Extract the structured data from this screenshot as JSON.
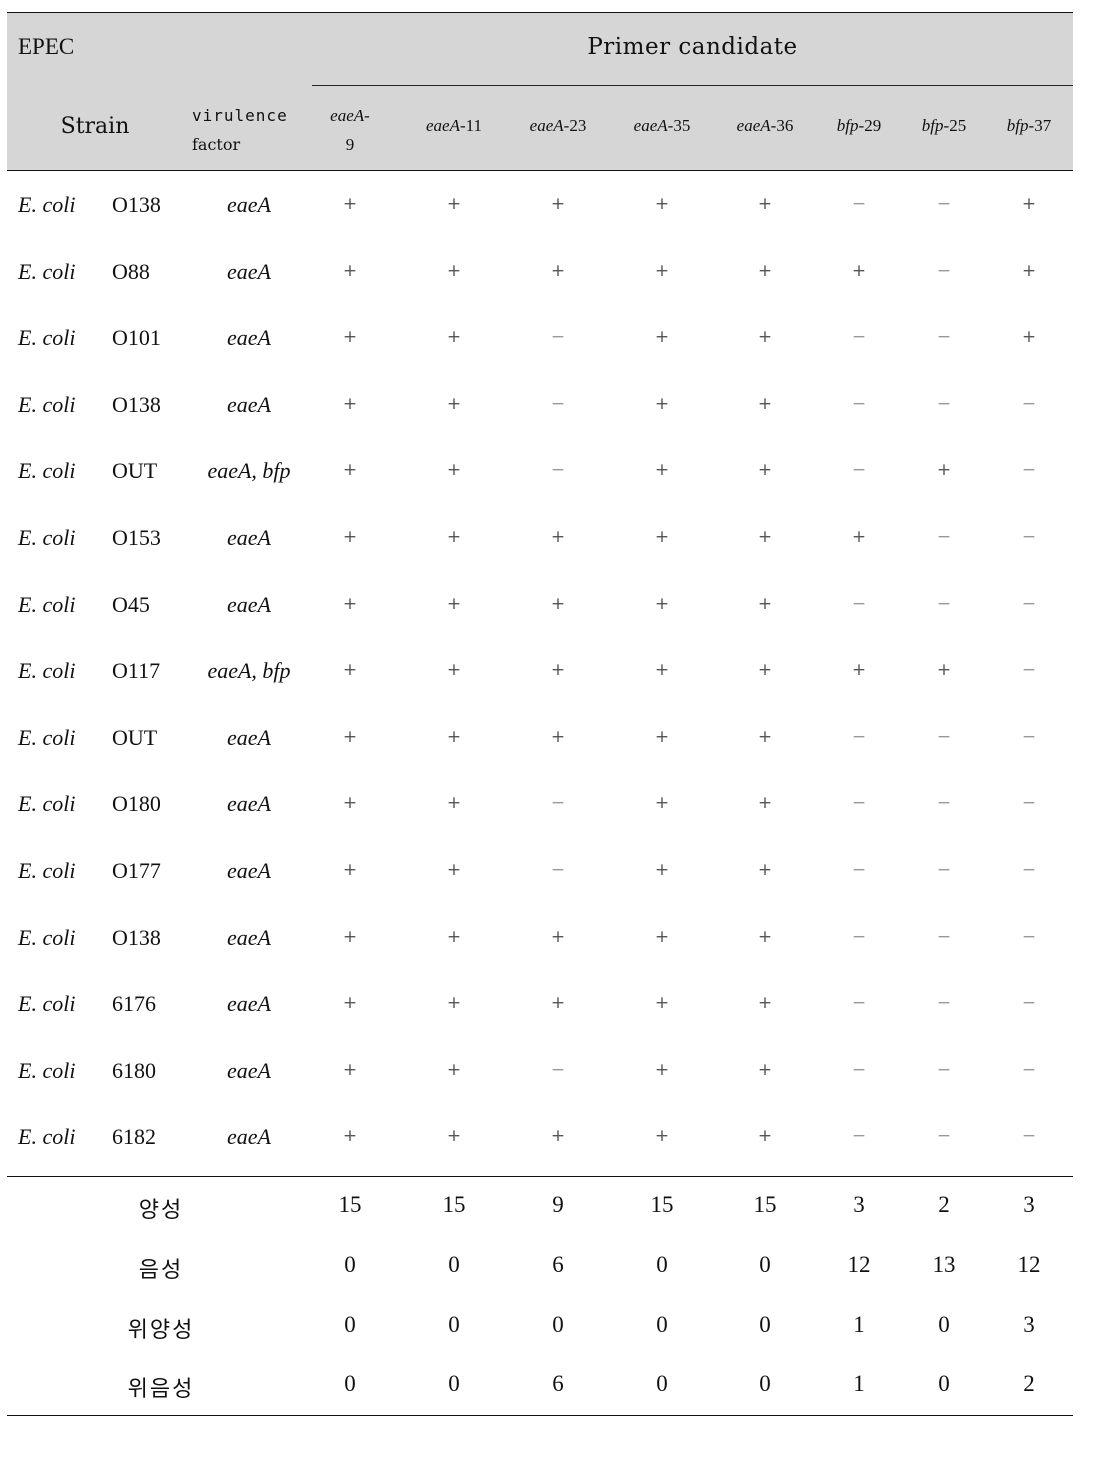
{
  "header": {
    "group_label": "EPEC",
    "primer_group_label": "Primer candidate",
    "strain_label": "Strain",
    "virulence_label_line1": "virulence",
    "virulence_label_line2": "factor",
    "primers": [
      {
        "gene": "eaeA",
        "num": "-9"
      },
      {
        "gene": "eaeA",
        "num": "-11"
      },
      {
        "gene": "eaeA",
        "num": "-23"
      },
      {
        "gene": "eaeA",
        "num": "-35"
      },
      {
        "gene": "eaeA",
        "num": "-36"
      },
      {
        "gene": "bfp",
        "num": "-29"
      },
      {
        "gene": "bfp",
        "num": "-25"
      },
      {
        "gene": "bfp",
        "num": "-37"
      }
    ]
  },
  "rows": [
    {
      "species": "E. coli",
      "serotype": "O138",
      "virulence": "eaeA",
      "results": [
        "+",
        "+",
        "+",
        "+",
        "+",
        "−",
        "−",
        "+"
      ]
    },
    {
      "species": "E. coli",
      "serotype": "O88",
      "virulence": "eaeA",
      "results": [
        "+",
        "+",
        "+",
        "+",
        "+",
        "+",
        "−",
        "+"
      ]
    },
    {
      "species": "E. coli",
      "serotype": "O101",
      "virulence": "eaeA",
      "results": [
        "+",
        "+",
        "−",
        "+",
        "+",
        "−",
        "−",
        "+"
      ]
    },
    {
      "species": "E. coli",
      "serotype": "O138",
      "virulence": "eaeA",
      "results": [
        "+",
        "+",
        "−",
        "+",
        "+",
        "−",
        "−",
        "−"
      ]
    },
    {
      "species": "E. coli",
      "serotype": "OUT",
      "virulence": "eaeA, bfp",
      "results": [
        "+",
        "+",
        "−",
        "+",
        "+",
        "−",
        "+",
        "−"
      ]
    },
    {
      "species": "E. coli",
      "serotype": "O153",
      "virulence": "eaeA",
      "results": [
        "+",
        "+",
        "+",
        "+",
        "+",
        "+",
        "−",
        "−"
      ]
    },
    {
      "species": "E. coli",
      "serotype": "O45",
      "virulence": "eaeA",
      "results": [
        "+",
        "+",
        "+",
        "+",
        "+",
        "−",
        "−",
        "−"
      ]
    },
    {
      "species": "E. coli",
      "serotype": "O117",
      "virulence": "eaeA, bfp",
      "results": [
        "+",
        "+",
        "+",
        "+",
        "+",
        "+",
        "+",
        "−"
      ]
    },
    {
      "species": "E. coli",
      "serotype": "OUT",
      "virulence": "eaeA",
      "results": [
        "+",
        "+",
        "+",
        "+",
        "+",
        "−",
        "−",
        "−"
      ]
    },
    {
      "species": "E. coli",
      "serotype": "O180",
      "virulence": "eaeA",
      "results": [
        "+",
        "+",
        "−",
        "+",
        "+",
        "−",
        "−",
        "−"
      ]
    },
    {
      "species": "E. coli",
      "serotype": "O177",
      "virulence": "eaeA",
      "results": [
        "+",
        "+",
        "−",
        "+",
        "+",
        "−",
        "−",
        "−"
      ]
    },
    {
      "species": "E. coli",
      "serotype": "O138",
      "virulence": "eaeA",
      "results": [
        "+",
        "+",
        "+",
        "+",
        "+",
        "−",
        "−",
        "−"
      ]
    },
    {
      "species": "E. coli",
      "serotype": "6176",
      "virulence": "eaeA",
      "results": [
        "+",
        "+",
        "+",
        "+",
        "+",
        "−",
        "−",
        "−"
      ]
    },
    {
      "species": "E. coli",
      "serotype": "6180",
      "virulence": "eaeA",
      "results": [
        "+",
        "+",
        "−",
        "+",
        "+",
        "−",
        "−",
        "−"
      ]
    },
    {
      "species": "E. coli",
      "serotype": "6182",
      "virulence": "eaeA",
      "results": [
        "+",
        "+",
        "+",
        "+",
        "+",
        "−",
        "−",
        "−"
      ]
    }
  ],
  "summary": [
    {
      "label": "양성",
      "values": [
        "15",
        "15",
        "9",
        "15",
        "15",
        "3",
        "2",
        "3"
      ]
    },
    {
      "label": "음성",
      "values": [
        "0",
        "0",
        "6",
        "0",
        "0",
        "12",
        "13",
        "12"
      ]
    },
    {
      "label": "위양성",
      "values": [
        "0",
        "0",
        "0",
        "0",
        "0",
        "1",
        "0",
        "3"
      ]
    },
    {
      "label": "위음성",
      "values": [
        "0",
        "0",
        "6",
        "0",
        "0",
        "1",
        "0",
        "2"
      ]
    }
  ]
}
